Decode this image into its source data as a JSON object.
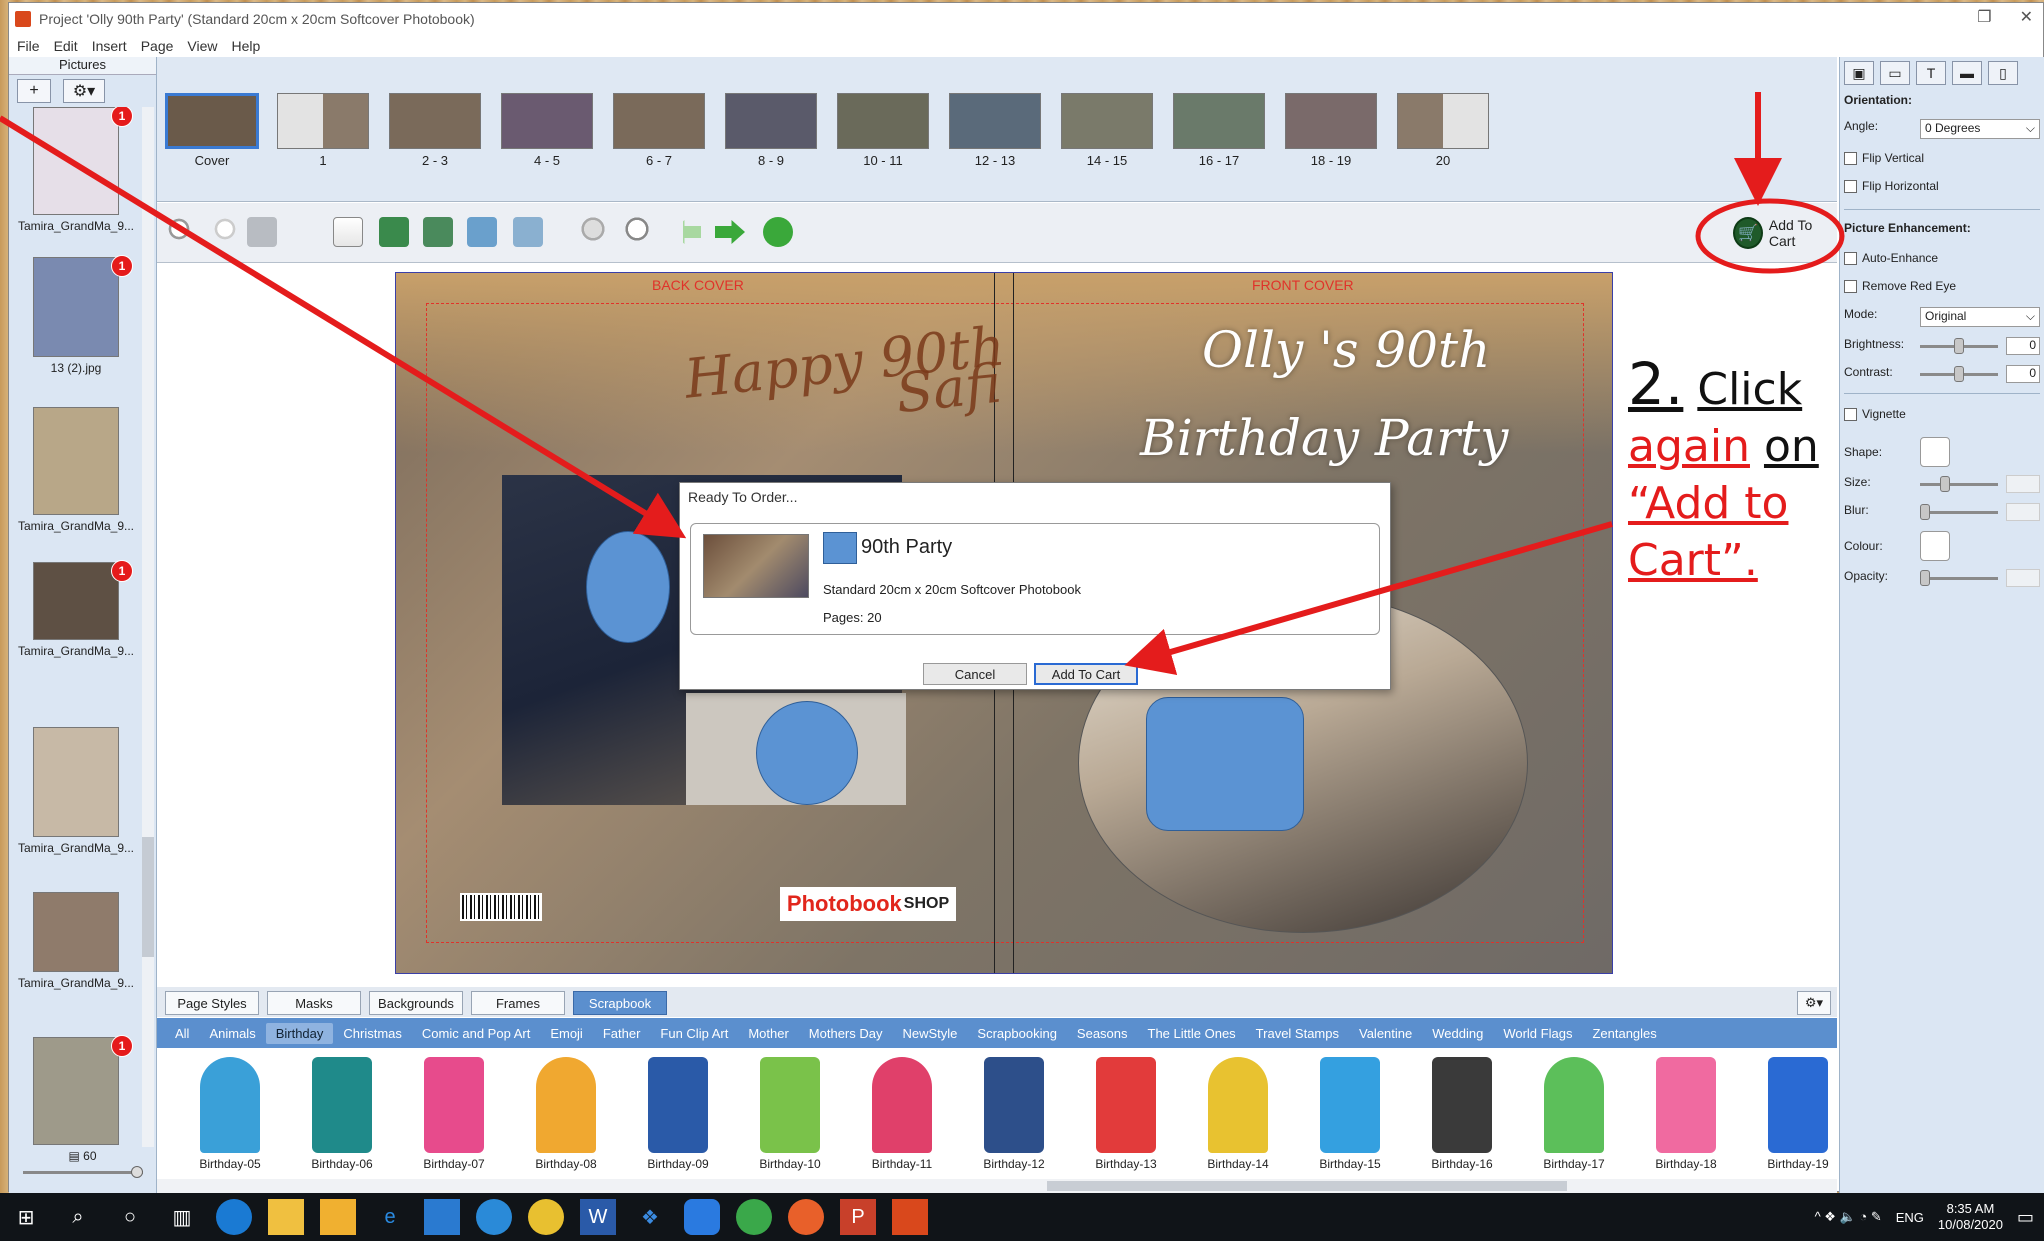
{
  "window": {
    "title": "Project 'Olly 90th Party' (Standard 20cm x 20cm Softcover Photobook)",
    "restore_glyph": "❐",
    "close_glyph": "✕"
  },
  "menu": [
    "File",
    "Edit",
    "Insert",
    "Page",
    "View",
    "Help"
  ],
  "left_panel": {
    "title": "Pictures",
    "add_label": "+",
    "settings_label": "⚙▾",
    "count": "60",
    "pictures": [
      {
        "name": "Tamira_GrandMa_9...",
        "badge": "1",
        "thumb_color": "#e6dfe8"
      },
      {
        "name": "13 (2).jpg",
        "badge": "1",
        "thumb_color": "#7a8ab0"
      },
      {
        "name": "Tamira_GrandMa_9...",
        "badge": "",
        "thumb_color": "#b8a788"
      },
      {
        "name": "Tamira_GrandMa_9...",
        "badge": "1",
        "thumb_color": "#5e5044"
      },
      {
        "name": "Tamira_GrandMa_9...",
        "badge": "",
        "thumb_color": "#c7b9a6"
      },
      {
        "name": "Tamira_GrandMa_9...",
        "badge": "",
        "thumb_color": "#8f7b6b"
      },
      {
        "name": "Tamira_GrandMa_9...",
        "badge": "1",
        "thumb_color": "#9e9a8a"
      }
    ]
  },
  "page_strip": {
    "pages": [
      "Cover",
      "1",
      "2 - 3",
      "4 - 5",
      "6 - 7",
      "8 - 9",
      "10 - 11",
      "12 - 13",
      "14 - 15",
      "16 - 17",
      "18 - 19",
      "20"
    ]
  },
  "toolbar": {
    "add_to_cart_label": "Add To Cart"
  },
  "spread": {
    "back_cover_label": "BACK COVER",
    "front_cover_label": "FRONT COVER",
    "cake_text_1": "Happy 90th",
    "cake_text_2": "Safi",
    "cover_title_1": "Olly 's 90th",
    "cover_title_2": "Birthday Party",
    "logo_a": "Photobook",
    "logo_b": "SHOP"
  },
  "dialog": {
    "title": "Ready To Order...",
    "project_name": "90th Party",
    "description": "Standard 20cm x 20cm Softcover Photobook",
    "pages": "Pages: 20",
    "cancel_label": "Cancel",
    "add_label": "Add To Cart"
  },
  "annotation": {
    "num": "2.",
    "w1": "Click",
    "w2": "again",
    "w3": "on",
    "w4": "“Add to",
    "w5": "Cart”."
  },
  "right_panel": {
    "orientation_label": "Orientation:",
    "angle_label": "Angle:",
    "angle_value": "0 Degrees",
    "flip_v": "Flip Vertical",
    "flip_h": "Flip Horizontal",
    "enh_label": "Picture Enhancement:",
    "auto_enhance": "Auto-Enhance",
    "red_eye": "Remove Red Eye",
    "mode_label": "Mode:",
    "mode_value": "Original",
    "brightness_label": "Brightness:",
    "brightness_value": "0",
    "contrast_label": "Contrast:",
    "contrast_value": "0",
    "vignette_label": "Vignette",
    "shape_label": "Shape:",
    "size_label": "Size:",
    "blur_label": "Blur:",
    "colour_label": "Colour:",
    "opacity_label": "Opacity:"
  },
  "library": {
    "tabs": [
      "Page Styles",
      "Masks",
      "Backgrounds",
      "Frames",
      "Scrapbook"
    ],
    "active_tab": "Scrapbook",
    "settings_label": "⚙▾",
    "categories": [
      "All",
      "Animals",
      "Birthday",
      "Christmas",
      "Comic and Pop Art",
      "Emoji",
      "Father",
      "Fun Clip Art",
      "Mother",
      "Mothers Day",
      "NewStyle",
      "Scrapbooking",
      "Seasons",
      "The Little Ones",
      "Travel Stamps",
      "Valentine",
      "Wedding",
      "World Flags",
      "Zentangles"
    ],
    "active_category": "Birthday",
    "items": [
      {
        "name": "Birthday-05",
        "color": "#3aa0d8"
      },
      {
        "name": "Birthday-06",
        "color": "#1f8a8a"
      },
      {
        "name": "Birthday-07",
        "color": "#e74b8c"
      },
      {
        "name": "Birthday-08",
        "color": "#f0a830"
      },
      {
        "name": "Birthday-09",
        "color": "#2a5aa8"
      },
      {
        "name": "Birthday-10",
        "color": "#7ac24a"
      },
      {
        "name": "Birthday-11",
        "color": "#e0406a"
      },
      {
        "name": "Birthday-12",
        "color": "#2d4f8a"
      },
      {
        "name": "Birthday-13",
        "color": "#e23b3b"
      },
      {
        "name": "Birthday-14",
        "color": "#e8c230"
      },
      {
        "name": "Birthday-15",
        "color": "#34a0e0"
      },
      {
        "name": "Birthday-16",
        "color": "#3a3a3a"
      },
      {
        "name": "Birthday-17",
        "color": "#5cbf5a"
      },
      {
        "name": "Birthday-18",
        "color": "#f06aa0"
      },
      {
        "name": "Birthday-19",
        "color": "#2a6ad3"
      }
    ]
  },
  "taskbar": {
    "lang": "ENG",
    "time": "8:35 AM",
    "date": "10/08/2020",
    "tray_icons": "^  ❖  🔈  ◔  ✎"
  }
}
